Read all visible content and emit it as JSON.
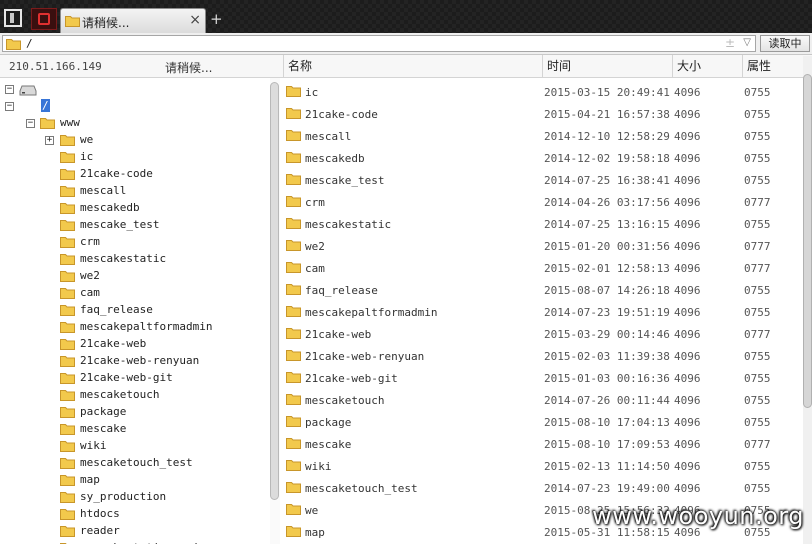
{
  "tab": {
    "title": "请稍候...",
    "close": "×",
    "add": "+"
  },
  "address": {
    "path": "/",
    "dropdown": "±",
    "arrow": "▽",
    "button": "读取中"
  },
  "left_pane": {
    "ip": "210.51.166.149",
    "status": "请稍候..."
  },
  "columns": {
    "name": "名称",
    "time": "时间",
    "size": "大小",
    "attr": "属性"
  },
  "tree": [
    {
      "label": "",
      "depth": 0,
      "expander": "−",
      "type": "drive"
    },
    {
      "label": "/",
      "depth": 1,
      "expander": "−",
      "selected": true
    },
    {
      "label": "www",
      "depth": 2,
      "expander": "−"
    },
    {
      "label": "we",
      "depth": 4,
      "expander": "+"
    },
    {
      "label": "ic",
      "depth": 4
    },
    {
      "label": "21cake-code",
      "depth": 4
    },
    {
      "label": "mescall",
      "depth": 4
    },
    {
      "label": "mescakedb",
      "depth": 4
    },
    {
      "label": "mescake_test",
      "depth": 4
    },
    {
      "label": "crm",
      "depth": 4
    },
    {
      "label": "mescakestatic",
      "depth": 4
    },
    {
      "label": "we2",
      "depth": 4
    },
    {
      "label": "cam",
      "depth": 4
    },
    {
      "label": "faq_release",
      "depth": 4
    },
    {
      "label": "mescakepaltformadmin",
      "depth": 4
    },
    {
      "label": "21cake-web",
      "depth": 4
    },
    {
      "label": "21cake-web-renyuan",
      "depth": 4
    },
    {
      "label": "21cake-web-git",
      "depth": 4
    },
    {
      "label": "mescaketouch",
      "depth": 4
    },
    {
      "label": "package",
      "depth": 4
    },
    {
      "label": "mescake",
      "depth": 4
    },
    {
      "label": "wiki",
      "depth": 4
    },
    {
      "label": "mescaketouch_test",
      "depth": 4
    },
    {
      "label": "map",
      "depth": 4
    },
    {
      "label": "sy_production",
      "depth": 4
    },
    {
      "label": "htdocs",
      "depth": 4
    },
    {
      "label": "reader",
      "depth": 4
    },
    {
      "label": "mescakestaticpreview",
      "depth": 4
    }
  ],
  "files": [
    {
      "name": "ic",
      "time": "2015-03-15 20:49:41",
      "size": "4096",
      "attr": "0755"
    },
    {
      "name": "21cake-code",
      "time": "2015-04-21 16:57:38",
      "size": "4096",
      "attr": "0755"
    },
    {
      "name": "mescall",
      "time": "2014-12-10 12:58:29",
      "size": "4096",
      "attr": "0755"
    },
    {
      "name": "mescakedb",
      "time": "2014-12-02 19:58:18",
      "size": "4096",
      "attr": "0755"
    },
    {
      "name": "mescake_test",
      "time": "2014-07-25 16:38:41",
      "size": "4096",
      "attr": "0755"
    },
    {
      "name": "crm",
      "time": "2014-04-26 03:17:56",
      "size": "4096",
      "attr": "0777"
    },
    {
      "name": "mescakestatic",
      "time": "2014-07-25 13:16:15",
      "size": "4096",
      "attr": "0755"
    },
    {
      "name": "we2",
      "time": "2015-01-20 00:31:56",
      "size": "4096",
      "attr": "0777"
    },
    {
      "name": "cam",
      "time": "2015-02-01 12:58:13",
      "size": "4096",
      "attr": "0777"
    },
    {
      "name": "faq_release",
      "time": "2015-08-07 14:26:18",
      "size": "4096",
      "attr": "0755"
    },
    {
      "name": "mescakepaltformadmin",
      "time": "2014-07-23 19:51:19",
      "size": "4096",
      "attr": "0755"
    },
    {
      "name": "21cake-web",
      "time": "2015-03-29 00:14:46",
      "size": "4096",
      "attr": "0777"
    },
    {
      "name": "21cake-web-renyuan",
      "time": "2015-02-03 11:39:38",
      "size": "4096",
      "attr": "0755"
    },
    {
      "name": "21cake-web-git",
      "time": "2015-01-03 00:16:36",
      "size": "4096",
      "attr": "0755"
    },
    {
      "name": "mescaketouch",
      "time": "2014-07-26 00:11:44",
      "size": "4096",
      "attr": "0755"
    },
    {
      "name": "package",
      "time": "2015-08-10 17:04:13",
      "size": "4096",
      "attr": "0755"
    },
    {
      "name": "mescake",
      "time": "2015-08-10 17:09:53",
      "size": "4096",
      "attr": "0777"
    },
    {
      "name": "wiki",
      "time": "2015-02-13 11:14:50",
      "size": "4096",
      "attr": "0755"
    },
    {
      "name": "mescaketouch_test",
      "time": "2014-07-23 19:49:00",
      "size": "4096",
      "attr": "0755"
    },
    {
      "name": "we",
      "time": "2015-08-25 15:56:32",
      "size": "4096",
      "attr": "0755"
    },
    {
      "name": "map",
      "time": "2015-05-31 11:58:15",
      "size": "4096",
      "attr": "0755"
    }
  ],
  "watermark": "www.wooyun.org",
  "colors": {
    "folder": "#f2c94c",
    "folder_edge": "#c8962a",
    "selection": "#3875d7",
    "topbar": "#1c1c1c"
  }
}
